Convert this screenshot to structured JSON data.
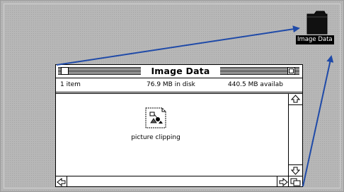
{
  "desktop": {
    "folder_label": "Image Data",
    "folder_icon": "folder-icon"
  },
  "window": {
    "title": "Image Data",
    "info": {
      "items": "1 item",
      "disk": "76.9 MB in disk",
      "available": "440.5 MB availab"
    },
    "content": {
      "file_label": "picture clipping",
      "file_icon": "picture-clipping-icon"
    }
  },
  "colors": {
    "desktop_gray": "#b7b7b7",
    "arrow_blue": "#1f4aa8"
  }
}
